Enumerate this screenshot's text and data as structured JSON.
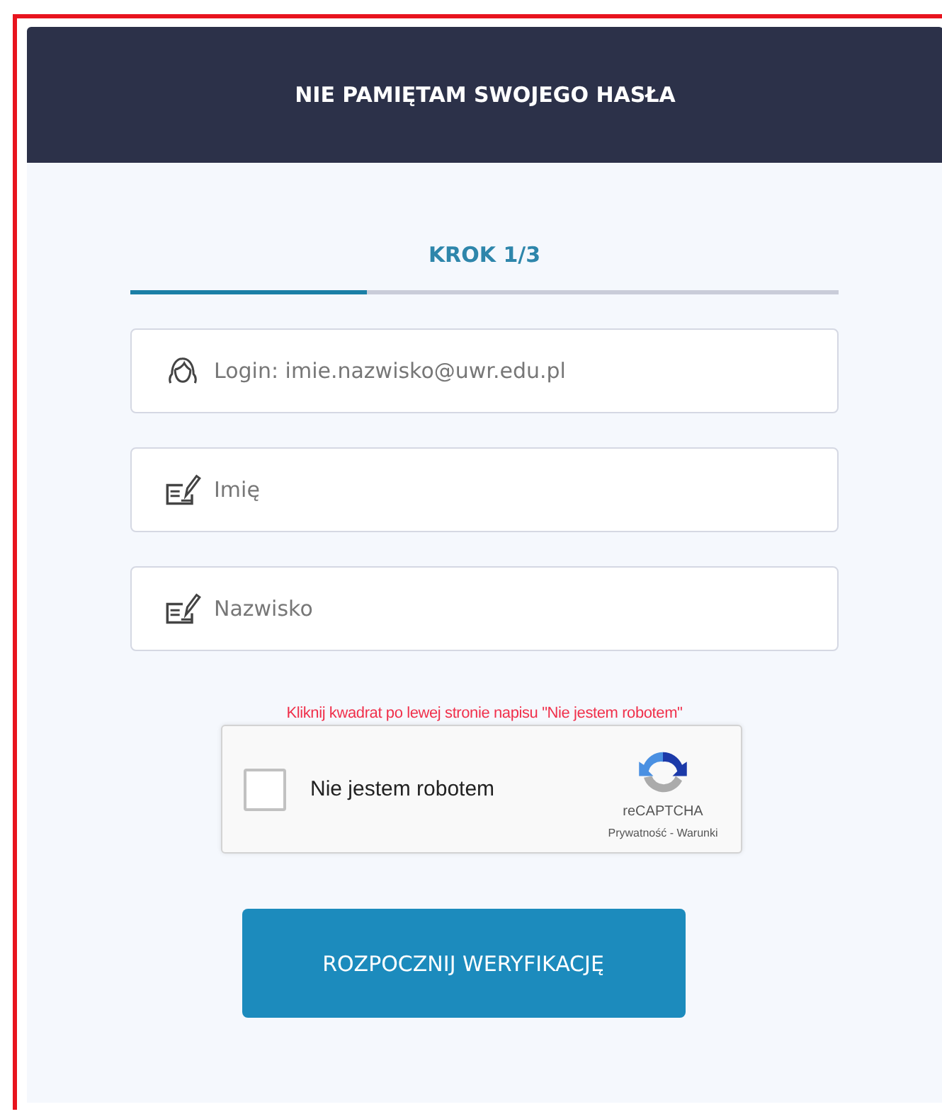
{
  "header": {
    "title": "NIE PAMIĘTAM SWOJEGO HASŁA"
  },
  "step": {
    "label": "KROK 1/3",
    "level": 0.333
  },
  "fields": [
    {
      "kind": "person",
      "placeholder": "Login: imie.nazwisko@uwr.edu.pl"
    },
    {
      "kind": "form",
      "placeholder": "Imię"
    },
    {
      "kind": "form",
      "placeholder": "Nazwisko"
    }
  ],
  "captcha_notice": "Kliknij kwadrat po lewej stronie napisu \"Nie jestem robotem\"",
  "captcha": {
    "label": "Nie jestem robotem",
    "checked": false,
    "brand": "reCAPTCHA",
    "links": "Prywatność - Warunki"
  },
  "submit": "ROZPOCZNIJ WERYFIKACJĘ"
}
